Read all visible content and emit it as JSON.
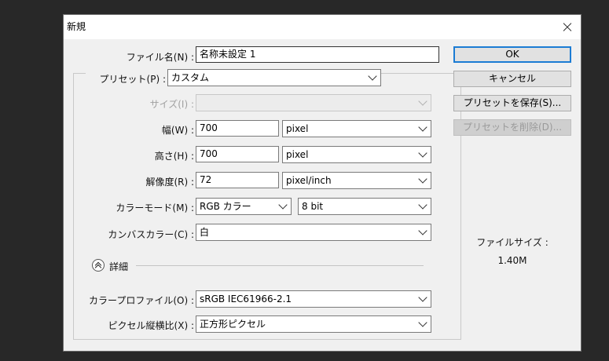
{
  "dialog": {
    "title": "新規",
    "close_icon": "close-icon"
  },
  "form": {
    "file_name": {
      "label": "ファイル名(N) :",
      "value": "名称未設定 1"
    },
    "preset": {
      "label": "プリセット(P) :",
      "value": "カスタム"
    },
    "size": {
      "label": "サイズ(I) :",
      "value": ""
    },
    "width": {
      "label": "幅(W) :",
      "value": "700",
      "unit": "pixel"
    },
    "height": {
      "label": "高さ(H) :",
      "value": "700",
      "unit": "pixel"
    },
    "resolution": {
      "label": "解像度(R) :",
      "value": "72",
      "unit": "pixel/inch"
    },
    "color_mode": {
      "label": "カラーモード(M) :",
      "mode": "RGB カラー",
      "depth": "8 bit"
    },
    "canvas_color": {
      "label": "カンバスカラー(C) :",
      "value": "白"
    },
    "details": {
      "label": "詳細",
      "icon": "collapse-up-icon"
    },
    "color_profile": {
      "label": "カラープロファイル(O) :",
      "value": "sRGB IEC61966-2.1"
    },
    "pixel_aspect": {
      "label": "ピクセル縦横比(X) :",
      "value": "正方形ピクセル"
    }
  },
  "buttons": {
    "ok": "OK",
    "cancel": "キャンセル",
    "save_preset": "プリセットを保存(S)...",
    "delete_preset": "プリセットを削除(D)..."
  },
  "file_info": {
    "label": "ファイルサイズ :",
    "value": "1.40M"
  },
  "colors": {
    "background": "#282828",
    "dialog": "#f0f0f0",
    "default_button_border": "#1c7cd4"
  }
}
